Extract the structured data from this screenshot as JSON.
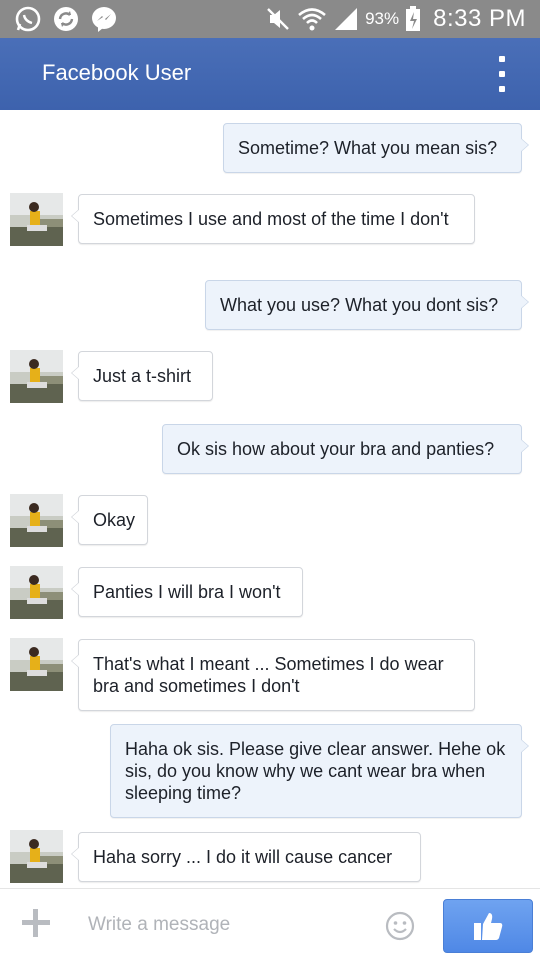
{
  "status_bar": {
    "battery_percent": "93%",
    "time": "8:33 PM",
    "icons": [
      "whatsapp-icon",
      "sync-icon",
      "messenger-icon",
      "mute-icon",
      "wifi-icon",
      "signal-icon",
      "battery-icon"
    ]
  },
  "header": {
    "title": "Facebook User",
    "menu_icon": "overflow-menu-icon",
    "color": "#4267b2"
  },
  "messages": [
    {
      "direction": "out",
      "text": "Sometime? What you mean sis?"
    },
    {
      "direction": "in",
      "text": "Sometimes I use and most of the time I don't"
    },
    {
      "direction": "out",
      "text": "What you use? What you dont sis?"
    },
    {
      "direction": "in",
      "text": "Just a t-shirt"
    },
    {
      "direction": "out",
      "text": "Ok sis how about your bra and panties?"
    },
    {
      "direction": "in",
      "text": "Okay"
    },
    {
      "direction": "in",
      "text": "Panties I will bra I won't"
    },
    {
      "direction": "in",
      "text": "That's what I meant ... Sometimes I do wear bra and sometimes I don't"
    },
    {
      "direction": "out",
      "text": "Haha ok sis. Please give clear answer. Hehe ok sis, do you know why we cant wear bra when sleeping time?"
    },
    {
      "direction": "in",
      "text": "Haha sorry ... I do it will cause cancer"
    }
  ],
  "composer": {
    "placeholder": "Write a message",
    "add_icon": "plus-icon",
    "emoji_icon": "smiley-icon",
    "send_icon": "thumbs-up-icon",
    "like_color": "#5b8fe8"
  }
}
